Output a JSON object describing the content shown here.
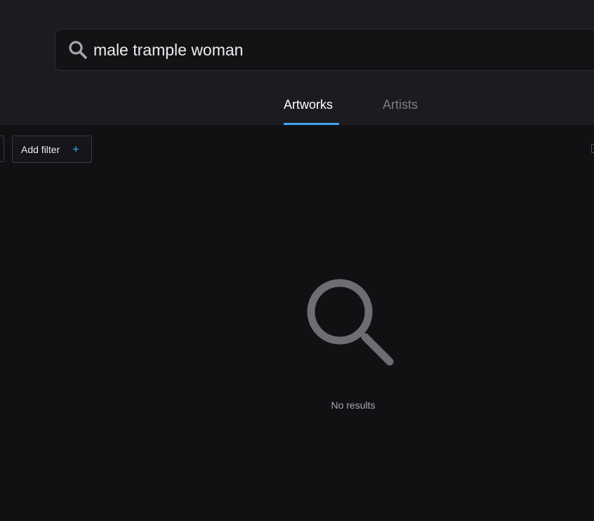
{
  "search": {
    "query": "male trample woman",
    "icon": "search-icon"
  },
  "tabs": [
    {
      "label": "Artworks",
      "active": true
    },
    {
      "label": "Artists",
      "active": false
    }
  ],
  "filters": {
    "add_filter_label": "Add filter",
    "add_icon": "plus-icon"
  },
  "results": {
    "empty_icon": "magnifier-icon",
    "empty_message": "No results"
  },
  "colors": {
    "accent": "#3ea6f2",
    "background": "#111114",
    "header": "#1c1c20"
  }
}
